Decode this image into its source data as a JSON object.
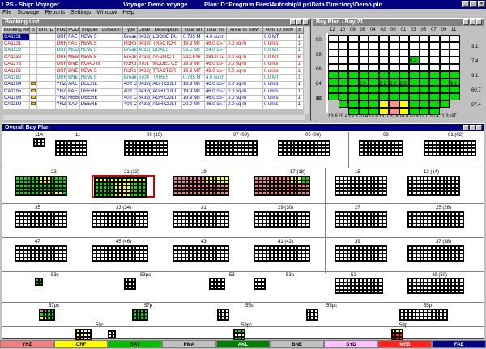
{
  "app": {
    "title": "LPS - Ship: Voyager",
    "voyage": "Voyage: Demo voyage",
    "plan": "Plan: D:\\Program Files\\Autoship\\Lps\\Data Directory\\Demo.pln"
  },
  "menu": [
    "File",
    "Stowage",
    "Reports",
    "Settings",
    "Window",
    "Help"
  ],
  "booking": {
    "title": "Booking List",
    "headers": [
      "Booking No.",
      "S",
      "Unit ID",
      "POL",
      "POD",
      "Shipper",
      "Location",
      "Type",
      "Code",
      "Description",
      "Total Wt",
      "Total Vol",
      "Area To Stow",
      "Amt To Stow",
      "E"
    ],
    "rows": [
      [
        "CA1131",
        "",
        "",
        "ORF",
        "FAE",
        "NEW S",
        "",
        "Break",
        "8432(",
        "LOOSE DU",
        "0.785 M",
        "4.0 cu-m",
        "",
        "0.0 MT",
        "1"
      ],
      [
        "CA1131",
        "",
        "",
        "ORF",
        "FAE",
        "NEW S",
        "",
        "RoRo",
        "8432(",
        "TRACTOR",
        "19.9 MT",
        "46.0 cu-r",
        "0.0 sq-m",
        "0 units",
        "1"
      ],
      [
        "CA1132",
        "",
        "",
        "ORF",
        "MEB",
        "NEW S",
        "",
        "Break",
        "4011(",
        "DUALS",
        "56.5 MT",
        "24.0 cu-r",
        "",
        "0.0 MT",
        "1"
      ],
      [
        "CA1132",
        "",
        "",
        "ORF",
        "MEB",
        "NEW S",
        "",
        "Break",
        "8432(",
        "AAGRIC T",
        "322.648",
        "281.0 cu",
        "0.0 sq-m",
        "0.0 MT",
        "6"
      ],
      [
        "CA1176",
        "",
        "",
        "ORF",
        "BNE",
        "ROAD N",
        "",
        "RoRo",
        "8701",
        "MODEL C5",
        "19.9 MT",
        "46.0 cu-r",
        "0.0 sq-m",
        "0 units",
        "1"
      ],
      [
        "CA1182",
        "",
        "",
        "ORF",
        "BNE",
        "NEW S",
        "",
        "RoRo",
        "8432(",
        "TRACTOR",
        "19.9 MT",
        "49.0 cu-r",
        "0.0 sq-m",
        "0 units",
        "1"
      ],
      [
        "CA1182",
        "",
        "",
        "ORF",
        "BNE",
        "NEW S",
        "",
        "Break",
        "8704",
        "TYRES",
        "0.785 M",
        "4.0 cu-m",
        "",
        "0.0 MT",
        "1"
      ],
      [
        "CA1194",
        "",
        "",
        "YHZ",
        "AKL",
        "DEERE",
        "",
        "40ft C",
        "8432(",
        "AGRICULT",
        "19.9 MT",
        "46.0 cu-r",
        "0.0 sq-m",
        "0 units",
        "1"
      ],
      [
        "CA1195",
        "",
        "",
        "YHZ",
        "FAE",
        "DEERE",
        "",
        "40ft C",
        "8432(",
        "AGRICULT",
        "19.9 MT",
        "46.0 cu-r",
        "0.0 sq-m",
        "0 units",
        "1"
      ],
      [
        "CA1196",
        "",
        "",
        "YHZ",
        "MEB",
        "DEERE",
        "",
        "40ft C",
        "8432(",
        "AGRICULT",
        "19.9 MT",
        "46.0 cu-r",
        "0.0 sq-m",
        "0 units",
        "1"
      ],
      [
        "CA1199",
        "",
        "",
        "YHZ",
        "SAV",
        "DEERE",
        "",
        "40ft C",
        "8432(",
        "AGRICULT",
        "20.0 MT",
        "46.0 cu-r",
        "0.0 sq-m",
        "0 units",
        "1"
      ]
    ],
    "row_colors": [
      "#000080",
      "#c00000",
      "#008080",
      "#c00000",
      "#c00000",
      "#c00000",
      "#008080",
      "#000080",
      "#000080",
      "#000080",
      "#000080"
    ]
  },
  "bay": {
    "title": "Bay Plan - Bay 21",
    "cols": [
      "12",
      "10",
      "08",
      "06",
      "04",
      "02",
      "00",
      "01",
      "03",
      "05",
      "07",
      "09",
      "11"
    ],
    "tiers": [
      "90",
      "88",
      "86",
      "84",
      "82"
    ],
    "right_vals": [
      "3.1",
      "7.4",
      "9.1",
      "60.7",
      "87.4"
    ],
    "center": "6.2",
    "cell_vals": [
      "6.2",
      "6.2",
      "6.2",
      "6.2",
      "6.2",
      "9.1"
    ],
    "bottom": [
      "13.6",
      "20.4",
      "19.3",
      "20.4",
      "19.8",
      "18.0",
      "20.8",
      "18.0",
      "20.8",
      "19.0",
      "20.4",
      "11.3",
      "MT"
    ],
    "left_label": "80"
  },
  "overall": {
    "title": "Overall Bay Plan",
    "bays": [
      "11A",
      "11",
      "09 (10)",
      "07 (08)",
      "05 (06)",
      "03",
      "01 (02)",
      "23",
      "21 (22)",
      "19",
      "17 (18)",
      "15",
      "13 (14)",
      "35",
      "33 (34)",
      "31",
      "29 (30)",
      "27",
      "25 (26)",
      "47",
      "45 (46)",
      "43",
      "41 (42)",
      "39",
      "37 (38)",
      "53s",
      "53pc",
      "53",
      "53p",
      "51",
      "49 (50)",
      "57pc",
      "57p",
      "55s",
      "55pc",
      "55p",
      "59c",
      "59pc",
      "59p"
    ]
  },
  "legend": [
    {
      "t": "YHZ",
      "c": "#f08080"
    },
    {
      "t": "ORF",
      "c": "#ffff00"
    },
    {
      "t": "SAV",
      "c": "#00c000"
    },
    {
      "t": "PMA",
      "c": "#c0c0c0"
    },
    {
      "t": "AKL",
      "c": "#008000"
    },
    {
      "t": "BNE",
      "c": "#c0c0c0"
    },
    {
      "t": "SYD",
      "c": "#ffc0ff"
    },
    {
      "t": "MEB",
      "c": "#ff2020"
    },
    {
      "t": "FAE",
      "c": "#000080"
    }
  ]
}
